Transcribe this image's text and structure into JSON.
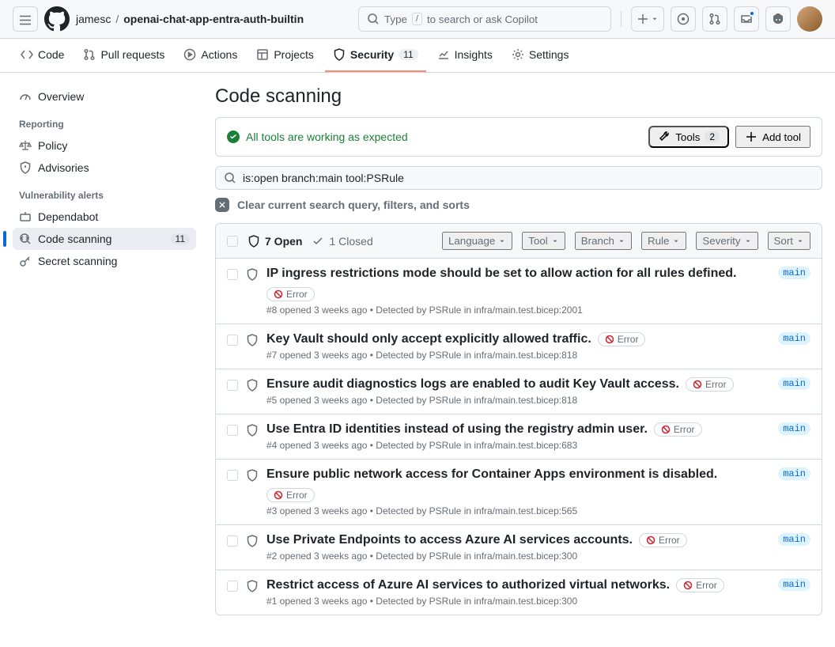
{
  "header": {
    "owner": "jamesc",
    "repo": "openai-chat-app-entra-auth-builtin",
    "search_placeholder_pre": "Type",
    "search_kbd": "/",
    "search_placeholder_post": "to search or ask Copilot"
  },
  "repo_nav": {
    "code": "Code",
    "pulls": "Pull requests",
    "actions": "Actions",
    "projects": "Projects",
    "security": "Security",
    "security_count": "11",
    "insights": "Insights",
    "settings": "Settings"
  },
  "sidebar": {
    "overview": "Overview",
    "group_reporting": "Reporting",
    "policy": "Policy",
    "advisories": "Advisories",
    "group_vuln": "Vulnerability alerts",
    "dependabot": "Dependabot",
    "code_scanning": "Code scanning",
    "code_scanning_count": "11",
    "secret_scanning": "Secret scanning"
  },
  "page": {
    "title": "Code scanning",
    "status_ok": "All tools are working as expected",
    "tools_label": "Tools",
    "tools_count": "2",
    "add_tool": "Add tool",
    "filter_value": "is:open branch:main tool:PSRule",
    "clear_label": "Clear current search query, filters, and sorts"
  },
  "list_header": {
    "open_label": "7 Open",
    "closed_label": "1 Closed",
    "language": "Language",
    "tool": "Tool",
    "branch": "Branch",
    "rule": "Rule",
    "severity": "Severity",
    "sort": "Sort"
  },
  "alerts": [
    {
      "title": "IP ingress restrictions mode should be set to allow action for all rules defined.",
      "badge": "Error",
      "num": "#8",
      "age": "3 weeks ago",
      "tool": "PSRule",
      "file": "infra/main.test.bicep:2001",
      "branch": "main"
    },
    {
      "title": "Key Vault should only accept explicitly allowed traffic.",
      "badge": "Error",
      "num": "#7",
      "age": "3 weeks ago",
      "tool": "PSRule",
      "file": "infra/main.test.bicep:818",
      "branch": "main"
    },
    {
      "title": "Ensure audit diagnostics logs are enabled to audit Key Vault access.",
      "badge": "Error",
      "num": "#5",
      "age": "3 weeks ago",
      "tool": "PSRule",
      "file": "infra/main.test.bicep:818",
      "branch": "main"
    },
    {
      "title": "Use Entra ID identities instead of using the registry admin user.",
      "badge": "Error",
      "num": "#4",
      "age": "3 weeks ago",
      "tool": "PSRule",
      "file": "infra/main.test.bicep:683",
      "branch": "main"
    },
    {
      "title": "Ensure public network access for Container Apps environment is disabled.",
      "badge": "Error",
      "num": "#3",
      "age": "3 weeks ago",
      "tool": "PSRule",
      "file": "infra/main.test.bicep:565",
      "branch": "main"
    },
    {
      "title": "Use Private Endpoints to access Azure AI services accounts.",
      "badge": "Error",
      "num": "#2",
      "age": "3 weeks ago",
      "tool": "PSRule",
      "file": "infra/main.test.bicep:300",
      "branch": "main"
    },
    {
      "title": "Restrict access of Azure AI services to authorized virtual networks.",
      "badge": "Error",
      "num": "#1",
      "age": "3 weeks ago",
      "tool": "PSRule",
      "file": "infra/main.test.bicep:300",
      "branch": "main"
    }
  ],
  "meta_strings": {
    "opened": "opened",
    "detected_by": "Detected by",
    "in": "in"
  }
}
